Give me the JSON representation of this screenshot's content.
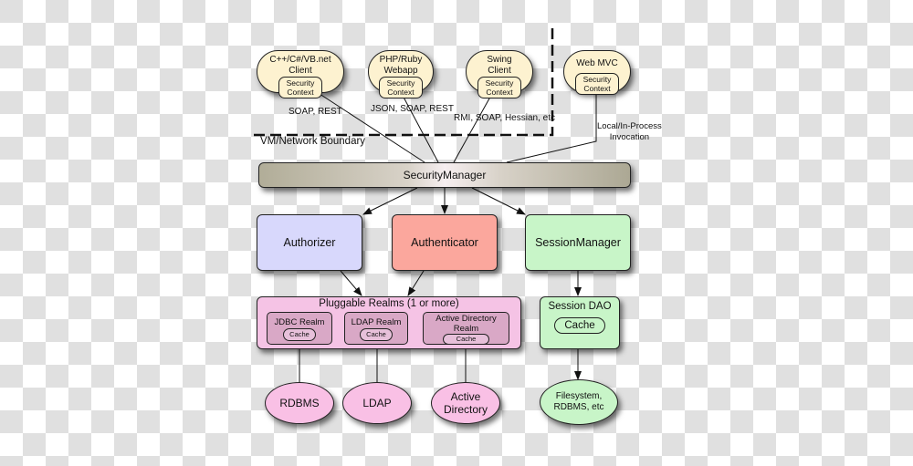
{
  "diagram": {
    "clients": [
      {
        "name": "C++/C#/VB.net Client",
        "line1": "C++/C#/VB.net",
        "line2": "Client",
        "context": [
          "Security",
          "Context"
        ]
      },
      {
        "name": "PHP/Ruby Webapp",
        "line1": "PHP/Ruby",
        "line2": "Webapp",
        "context": [
          "Security",
          "Context"
        ]
      },
      {
        "name": "Swing Client",
        "line1": "Swing",
        "line2": "Client",
        "context": [
          "Security",
          "Context"
        ]
      },
      {
        "name": "Web MVC",
        "line1": "Web MVC",
        "line2": "",
        "context": [
          "Security",
          "Context"
        ]
      }
    ],
    "protocols": {
      "cpp": "SOAP, REST",
      "php": "JSON, SOAP, REST",
      "swing": "RMI, SOAP, Hessian, etc",
      "web_line1": "Local/In-Process",
      "web_line2": "Invocation"
    },
    "boundary_label": "VM/Network Boundary",
    "security_manager": "SecurityManager",
    "components": {
      "authorizer": "Authorizer",
      "authenticator": "Authenticator",
      "session_manager": "SessionManager"
    },
    "realms": {
      "title": "Pluggable Realms (1 or more)",
      "items": [
        {
          "name": "JDBC Realm",
          "cache": "Cache"
        },
        {
          "name": "LDAP Realm",
          "cache": "Cache"
        },
        {
          "name_line1": "Active Directory",
          "name_line2": "Realm",
          "cache": "Cache"
        }
      ]
    },
    "session_dao": {
      "title": "Session DAO",
      "cache": "Cache"
    },
    "datastores": {
      "rdbms": "RDBMS",
      "ldap": "LDAP",
      "ad_line1": "Active",
      "ad_line2": "Directory",
      "fs_line1": "Filesystem,",
      "fs_line2": "RDBMS, etc"
    },
    "colors": {
      "client_fill": "#fdf2d0",
      "authorizer_fill": "#d8d8fc",
      "authenticator_fill": "#fba79d",
      "session_fill": "#c8f5c8",
      "realm_fill": "#f5c3e5",
      "datastore_fill": "#f9c0e5"
    }
  }
}
